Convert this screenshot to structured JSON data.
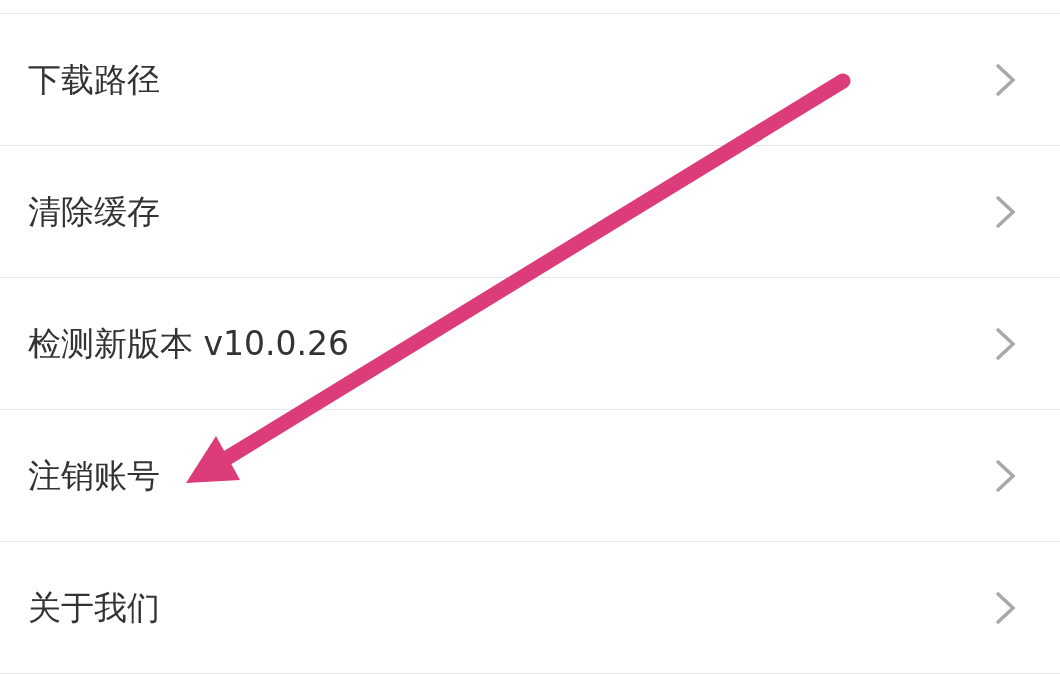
{
  "settings_list": {
    "items": [
      {
        "label": "下载路径"
      },
      {
        "label": "清除缓存"
      },
      {
        "label": "检测新版本 v10.0.26"
      },
      {
        "label": "注销账号"
      },
      {
        "label": "关于我们"
      }
    ]
  }
}
